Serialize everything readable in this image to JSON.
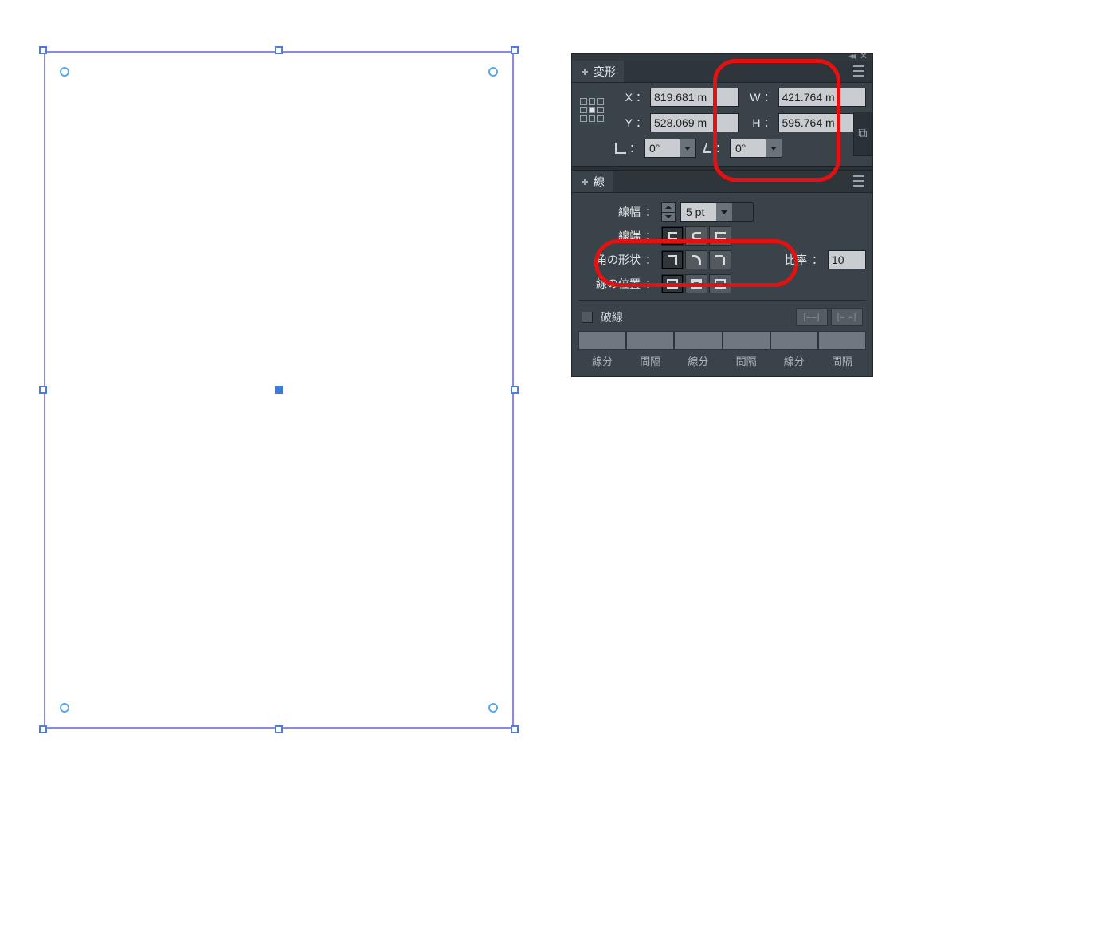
{
  "transform": {
    "tab_label": "変形",
    "x_label": "X",
    "y_label": "Y",
    "w_label": "W",
    "h_label": "H",
    "x_value": "819.681 m",
    "y_value": "528.069 m",
    "w_value": "421.764 m",
    "h_value": "595.764 m",
    "rotate_value": "0°",
    "shear_value": "0°",
    "link_label": "⧉"
  },
  "stroke": {
    "tab_label": "線",
    "width_label": "線幅",
    "width_value": "5 pt",
    "cap_label": "線端",
    "join_label": "角の形状",
    "miter_label": "比率",
    "miter_value": "10",
    "align_label": "線の位置",
    "dash_label": "破線",
    "dash_cols": [
      "線分",
      "間隔",
      "線分",
      "間隔",
      "線分",
      "間隔"
    ]
  },
  "colon": "："
}
